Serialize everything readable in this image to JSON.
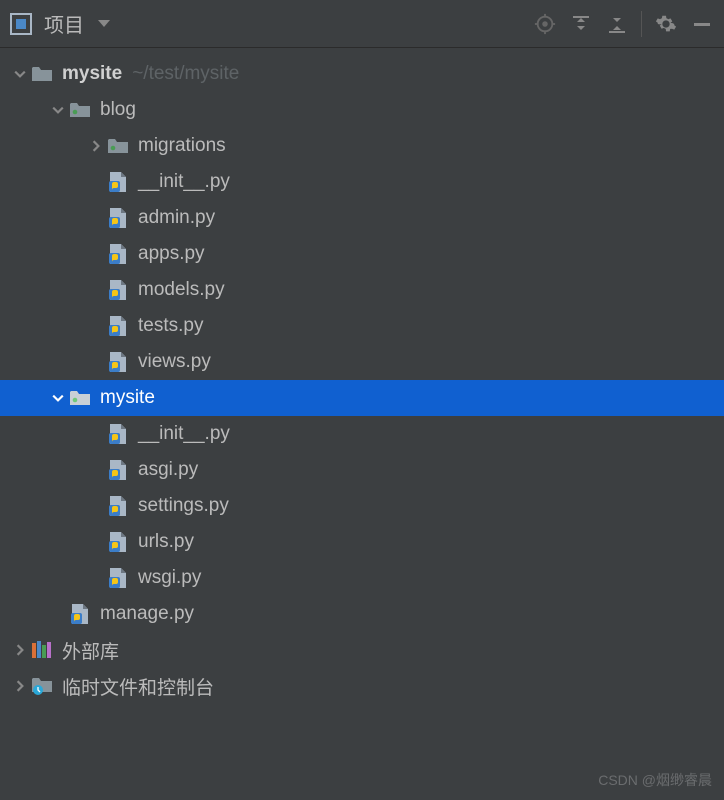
{
  "toolbar": {
    "title": "项目"
  },
  "tree": {
    "root": {
      "name": "mysite",
      "path": "~/test/mysite"
    },
    "blog": {
      "name": "blog",
      "migrations": "migrations",
      "files": {
        "init": "__init__.py",
        "admin": "admin.py",
        "apps": "apps.py",
        "models": "models.py",
        "tests": "tests.py",
        "views": "views.py"
      }
    },
    "mysite_pkg": {
      "name": "mysite",
      "files": {
        "init": "__init__.py",
        "asgi": "asgi.py",
        "settings": "settings.py",
        "urls": "urls.py",
        "wsgi": "wsgi.py"
      }
    },
    "manage": "manage.py",
    "external_libs": "外部库",
    "scratches": "临时文件和控制台"
  },
  "watermark": "CSDN @烟缈睿晨"
}
